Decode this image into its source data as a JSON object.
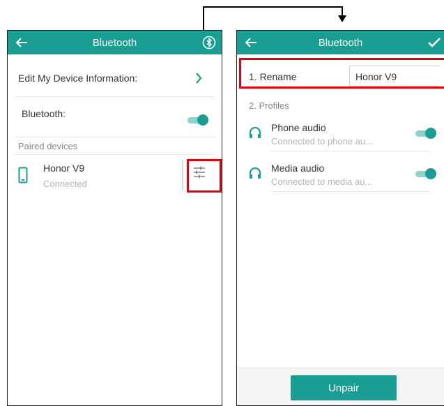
{
  "left": {
    "title": "Bluetooth",
    "edit_device_label": "Edit My Device Information:",
    "bluetooth_label": "Bluetooth:",
    "bluetooth_enabled": true,
    "paired_devices_header": "Paired devices",
    "device": {
      "name": "Honor V9",
      "status": "Connected"
    }
  },
  "right": {
    "title": "Bluetooth",
    "rename_label": "1. Rename",
    "rename_value": "Honor V9",
    "profiles_header": "2. Profiles",
    "profiles": [
      {
        "name": "Phone audio",
        "status": "Connected to phone au...",
        "enabled": true
      },
      {
        "name": "Media audio",
        "status": "Connected to media au...",
        "enabled": true
      }
    ],
    "unpair_label": "Unpair"
  },
  "colors": {
    "accent": "#1a9e93",
    "highlight": "#e10010"
  }
}
